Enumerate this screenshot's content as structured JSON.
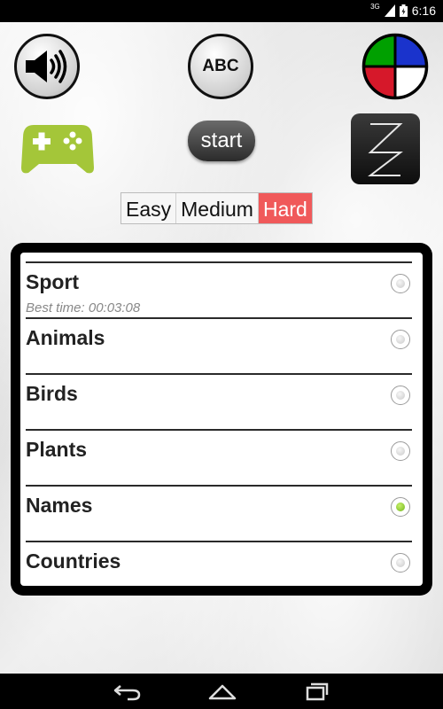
{
  "status_bar": {
    "network_label": "3G",
    "time": "6:16"
  },
  "toolbar": {
    "sound_icon": "speaker-icon",
    "abc_label": "ABC",
    "colors_icon": "color-wheel-icon",
    "colors": [
      "#00a000",
      "#1a33cc",
      "#d6182a",
      "#ffffff"
    ],
    "gamepad_icon": "gamepad-icon",
    "gamepad_color": "#a4c639",
    "start_label": "start",
    "sleep_icon": "zz-icon"
  },
  "difficulty": {
    "options": [
      "Easy",
      "Medium",
      "Hard"
    ],
    "selected": "Hard",
    "active_color": "#f0595a"
  },
  "categories": [
    {
      "label": "Sport",
      "subtitle": "Best time: 00:03:08",
      "selected": false
    },
    {
      "label": "Animals",
      "subtitle": "",
      "selected": false
    },
    {
      "label": "Birds",
      "subtitle": "",
      "selected": false
    },
    {
      "label": "Plants",
      "subtitle": "",
      "selected": false
    },
    {
      "label": "Names",
      "subtitle": "",
      "selected": true
    },
    {
      "label": "Countries",
      "subtitle": "",
      "selected": false
    }
  ],
  "nav": {
    "back_icon": "back-icon",
    "home_icon": "home-icon",
    "recents_icon": "recents-icon"
  }
}
